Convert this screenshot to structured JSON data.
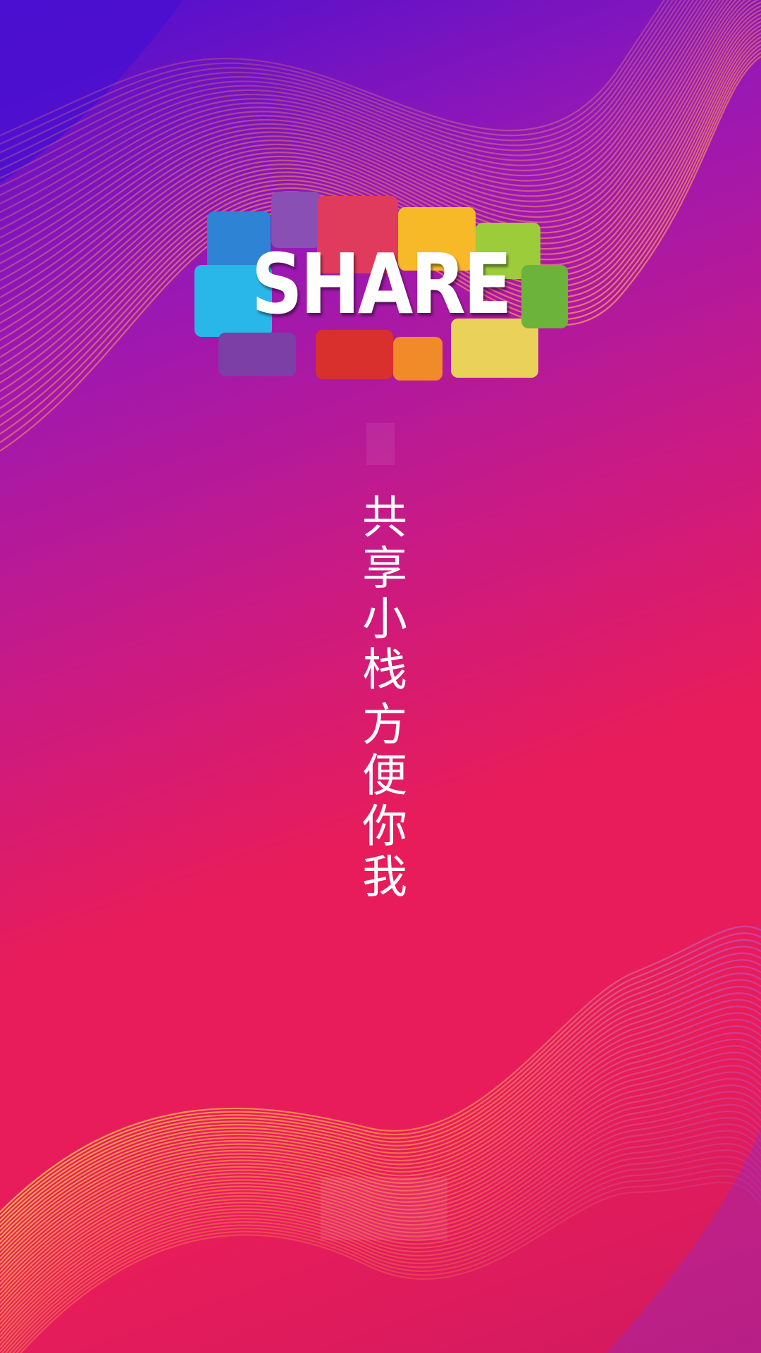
{
  "logo": {
    "word": "SHARE",
    "bubble_colors": [
      "#2f83d4",
      "#8a4fb5",
      "#e03a5c",
      "#f7b928",
      "#9ccc3a",
      "#29b6e8",
      "#7b3fa6",
      "#d9302d",
      "#f18b2a",
      "#e9d15a",
      "#6bb33a"
    ]
  },
  "slogan": {
    "line1": "共享小栈",
    "line2": "方便你我"
  },
  "colors": {
    "background": "#e81c5a",
    "top_left": "#4a0fd0",
    "wave_line": "#f6c23a"
  }
}
